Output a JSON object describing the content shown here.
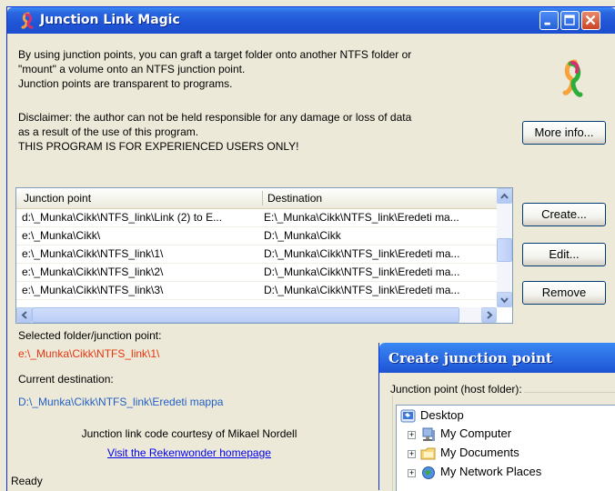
{
  "window": {
    "title": "Junction Link Magic",
    "buttons": {
      "minimize": "minimize",
      "maximize": "maximize",
      "close": "close"
    }
  },
  "intro": {
    "line1": "By using junction points, you can graft a target folder onto another NTFS folder or",
    "line2": "\"mount\" a volume onto an NTFS junction point.",
    "line3": "Junction points are transparent to programs."
  },
  "disclaimer": {
    "line1": "Disclaimer: the author can not be held responsible for any damage or loss of data",
    "line2": "as a result of the use of this program.",
    "line3": "THIS PROGRAM IS FOR EXPERIENCED USERS ONLY!"
  },
  "buttons": {
    "more_info": "More info...",
    "create": "Create...",
    "edit": "Edit...",
    "remove": "Remove"
  },
  "list": {
    "columns": [
      "Junction point",
      "Destination"
    ],
    "rows": [
      {
        "junction": "d:\\_Munka\\Cikk\\NTFS_link\\Link (2) to E...",
        "destination": "E:\\_Munka\\Cikk\\NTFS_link\\Eredeti ma..."
      },
      {
        "junction": "e:\\_Munka\\Cikk\\",
        "destination": "D:\\_Munka\\Cikk"
      },
      {
        "junction": "e:\\_Munka\\Cikk\\NTFS_link\\1\\",
        "destination": "D:\\_Munka\\Cikk\\NTFS_link\\Eredeti ma..."
      },
      {
        "junction": "e:\\_Munka\\Cikk\\NTFS_link\\2\\",
        "destination": "D:\\_Munka\\Cikk\\NTFS_link\\Eredeti ma..."
      },
      {
        "junction": "e:\\_Munka\\Cikk\\NTFS_link\\3\\",
        "destination": "D:\\_Munka\\Cikk\\NTFS_link\\Eredeti ma..."
      }
    ]
  },
  "selected": {
    "label": "Selected folder/junction point:",
    "value": "e:\\_Munka\\Cikk\\NTFS_link\\1\\"
  },
  "current": {
    "label": "Current destination:",
    "value": "D:\\_Munka\\Cikk\\NTFS_link\\Eredeti mappa"
  },
  "credits": {
    "text": "Junction link code courtesy of Mikael Nordell",
    "link": "Visit the Rekenwonder homepage"
  },
  "status": "Ready",
  "dialog": {
    "title": "Create junction point",
    "group_label": "Junction point (host folder):",
    "tree": {
      "root": "Desktop",
      "children": [
        "My Computer",
        "My Documents",
        "My Network Places"
      ]
    }
  },
  "colors": {
    "title_bar": "#1f55d6",
    "selected_text": "#e8340e",
    "destination_text": "#2460c4",
    "face": "#ece9d8"
  }
}
